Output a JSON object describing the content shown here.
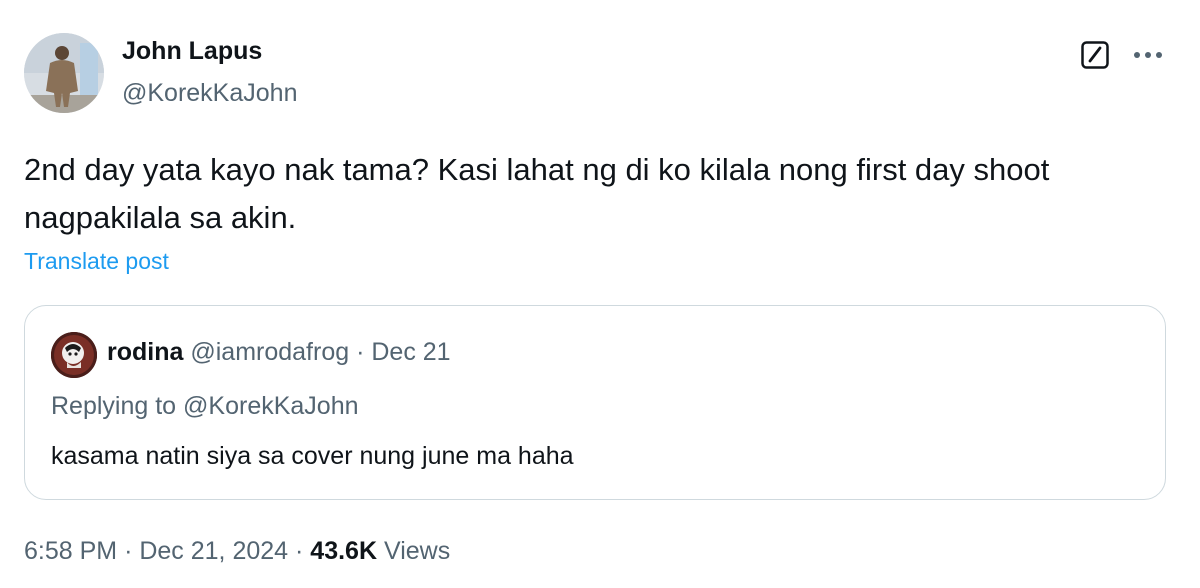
{
  "author": {
    "name": "John Lapus",
    "handle": "@KorekKaJohn"
  },
  "post": {
    "text": "2nd day yata kayo nak tama? Kasi lahat ng di ko kilala nong first day shoot nagpakilala sa akin.",
    "translate_label": "Translate post"
  },
  "quote": {
    "name": "rodina",
    "handle": "@iamrodafrog",
    "separator": "·",
    "date": "Dec 21",
    "replying_prefix": "Replying to",
    "replying_handle": "@KorekKaJohn",
    "text": "kasama natin siya sa cover nung june ma haha"
  },
  "footer": {
    "time": "6:58 PM",
    "separator1": "·",
    "date": "Dec 21, 2024",
    "separator2": "·",
    "views_count": "43.6K",
    "views_label": "Views"
  },
  "icons": {
    "grok": "grok-icon",
    "more": "more-icon"
  },
  "colors": {
    "text_primary": "#0f1419",
    "text_secondary": "#536471",
    "link": "#1d9bf0",
    "border": "#cfd9de"
  }
}
